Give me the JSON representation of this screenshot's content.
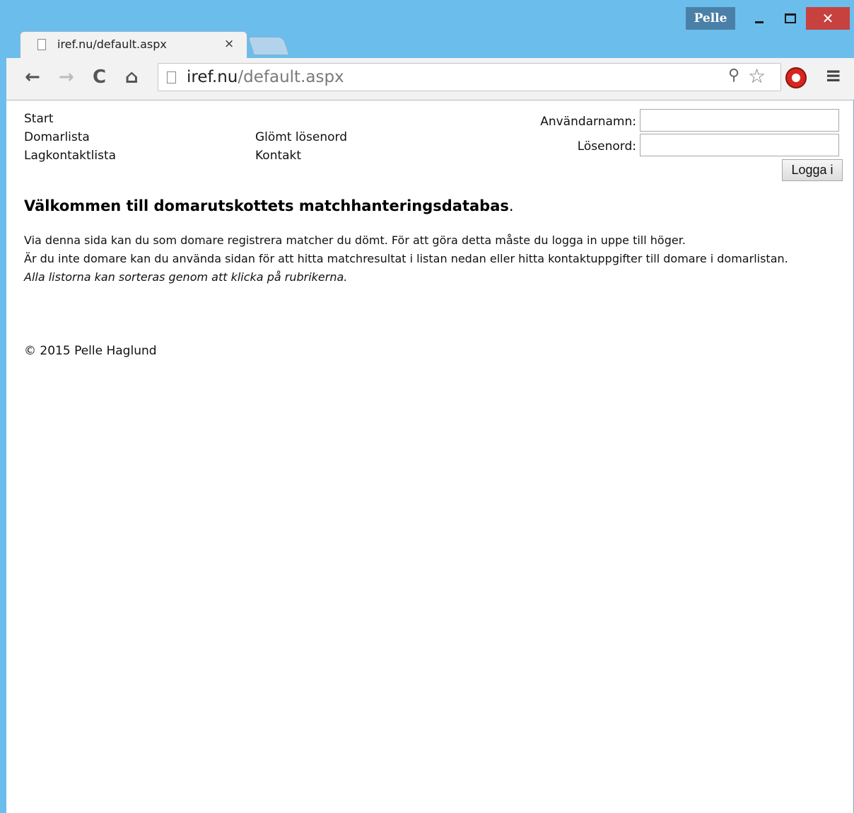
{
  "browser": {
    "profile_name": "Pelle",
    "tab_title": "iref.nu/default.aspx",
    "tab_close": "×",
    "url_host": "iref.nu",
    "url_path": "/default.aspx",
    "icons": {
      "back": "back-arrow-icon",
      "forward": "forward-arrow-icon",
      "reload": "reload-icon",
      "home": "home-icon",
      "key": "key-icon",
      "star": "bookmark-star-icon",
      "extension": "adblock-icon",
      "menu": "hamburger-menu-icon"
    },
    "close_color": "#c7413e",
    "frame_color": "#6bbdec"
  },
  "nav": {
    "start": "Start",
    "domarlista": "Domarlista",
    "lagkontaktlista": "Lagkontaktlista",
    "glomt": "Glömt lösenord",
    "kontakt": "Kontakt"
  },
  "login": {
    "username_label": "Användarnamn:",
    "password_label": "Lösenord:",
    "username_value": "",
    "password_value": "",
    "button_label": "Logga i"
  },
  "main": {
    "heading": "Välkommen till domarutskottets matchhanteringsdatabas",
    "heading_dot": ".",
    "line1": "Via denna sida kan du som domare registrera matcher du dömt. För att göra detta måste du logga in uppe till höger.",
    "line2": "Är du inte domare kan du använda sidan för att hitta matchresultat i listan nedan eller hitta kontaktuppgifter till domare i domarlistan.",
    "line3": "Alla listorna kan sorteras genom att klicka på rubrikerna."
  },
  "footer": {
    "copyright": "© 2015 Pelle Haglund"
  }
}
